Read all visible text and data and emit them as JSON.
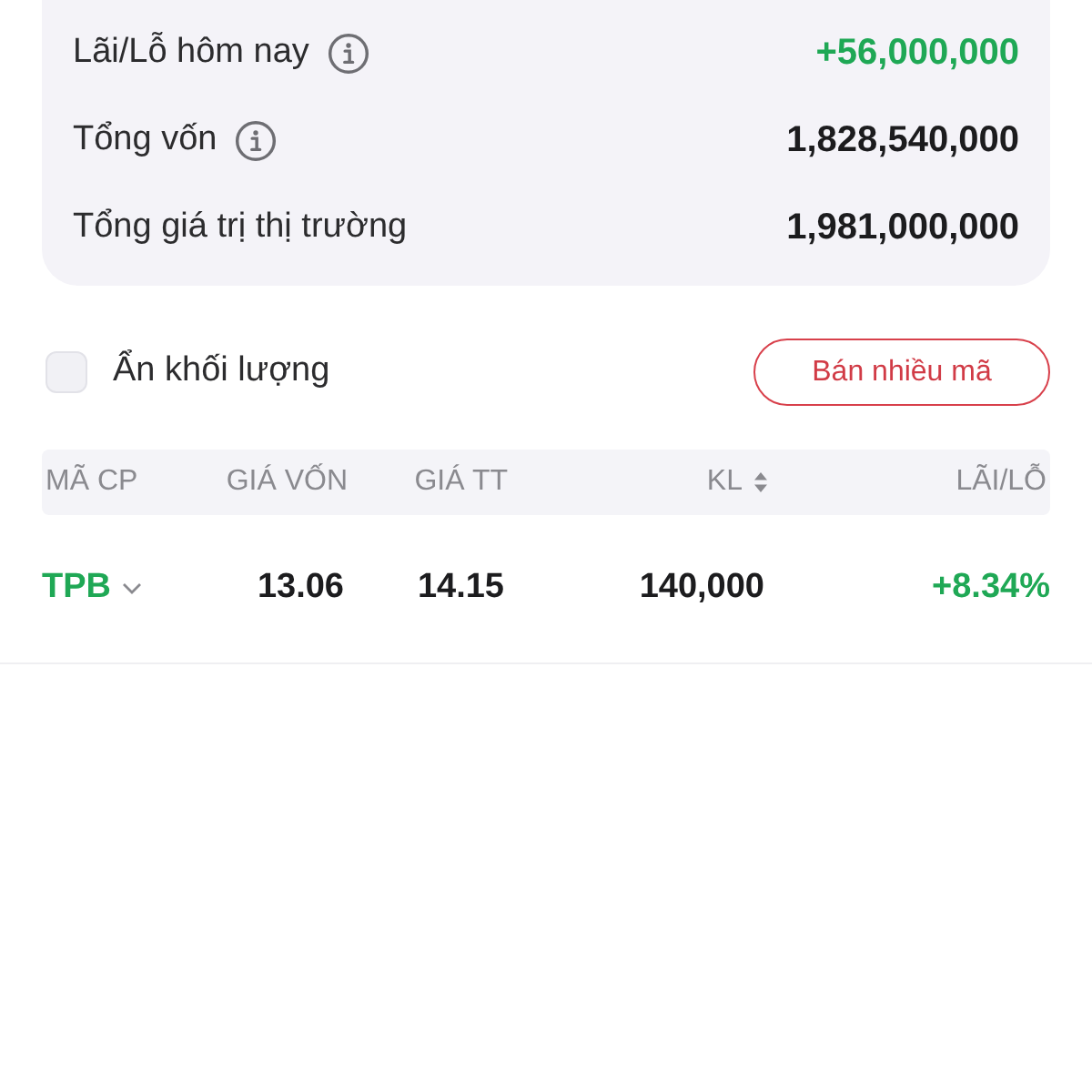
{
  "summary": {
    "rows": [
      {
        "label": "Lãi/Lỗ hôm nay",
        "info": true,
        "value": "+56,000,000",
        "color": "#1fa855"
      },
      {
        "label": "Tổng vốn",
        "info": true,
        "value": "1,828,540,000",
        "color": "#1c1c1e"
      },
      {
        "label": "Tổng giá trị thị trường",
        "info": false,
        "value": "1,981,000,000",
        "color": "#1c1c1e"
      }
    ]
  },
  "options": {
    "hide_volume": {
      "label": "Ẩn khối lượng",
      "checked": false
    },
    "sell_button": "Bán nhiều mã"
  },
  "table": {
    "columns": [
      {
        "label": "MÃ CP",
        "sortable": false
      },
      {
        "label": "GIÁ VỐN",
        "sortable": false
      },
      {
        "label": "GIÁ TT",
        "sortable": false
      },
      {
        "label": "KL",
        "sortable": true
      },
      {
        "label": "LÃI/LỖ",
        "sortable": false
      }
    ],
    "rows": [
      {
        "symbol": "TPB",
        "expanded": false,
        "color": "#1fa855",
        "cost": "13.06",
        "price": "14.15",
        "volume": "140,000",
        "change": "+8.34%"
      }
    ]
  }
}
